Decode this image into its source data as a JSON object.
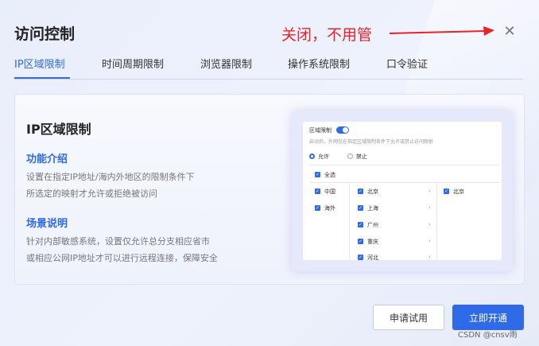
{
  "dialog": {
    "title": "访问控制",
    "close_icon": "close-icon"
  },
  "annotation": {
    "text": "关闭，不用管",
    "color": "#e8232a"
  },
  "tabs": [
    {
      "label": "IP区域限制",
      "active": true
    },
    {
      "label": "时间周期限制",
      "active": false
    },
    {
      "label": "浏览器限制",
      "active": false
    },
    {
      "label": "操作系统限制",
      "active": false
    },
    {
      "label": "口令验证",
      "active": false
    }
  ],
  "card": {
    "title": "IP区域限制",
    "intro_heading": "功能介绍",
    "intro_lines": [
      "设置在指定IP地址/海内外地区的限制条件下",
      "所选定的映射才允许或拒绝被访问"
    ],
    "scene_heading": "场景说明",
    "scene_lines": [
      "针对内部敏感系统，设置仅允许总分支相应省市",
      "或相应公网IP地址才可以进行远程连接，保障安全"
    ]
  },
  "preview": {
    "toggle_label": "区域限制",
    "description": "启动后，外网仅在指定区域限制条件下允许或禁止访问映射",
    "radio_allow": "允许",
    "radio_deny": "禁止",
    "select_all": "全选",
    "col1": [
      "中国",
      "海外"
    ],
    "col2": [
      "北京",
      "上海",
      "广州",
      "重庆",
      "河北"
    ],
    "col3": [
      "北京"
    ]
  },
  "buttons": {
    "trial": "申请试用",
    "open": "立即开通"
  },
  "watermark": "CSDN @cnsv雨",
  "colors": {
    "accent": "#2f6ae8",
    "annotation": "#e8232a"
  }
}
